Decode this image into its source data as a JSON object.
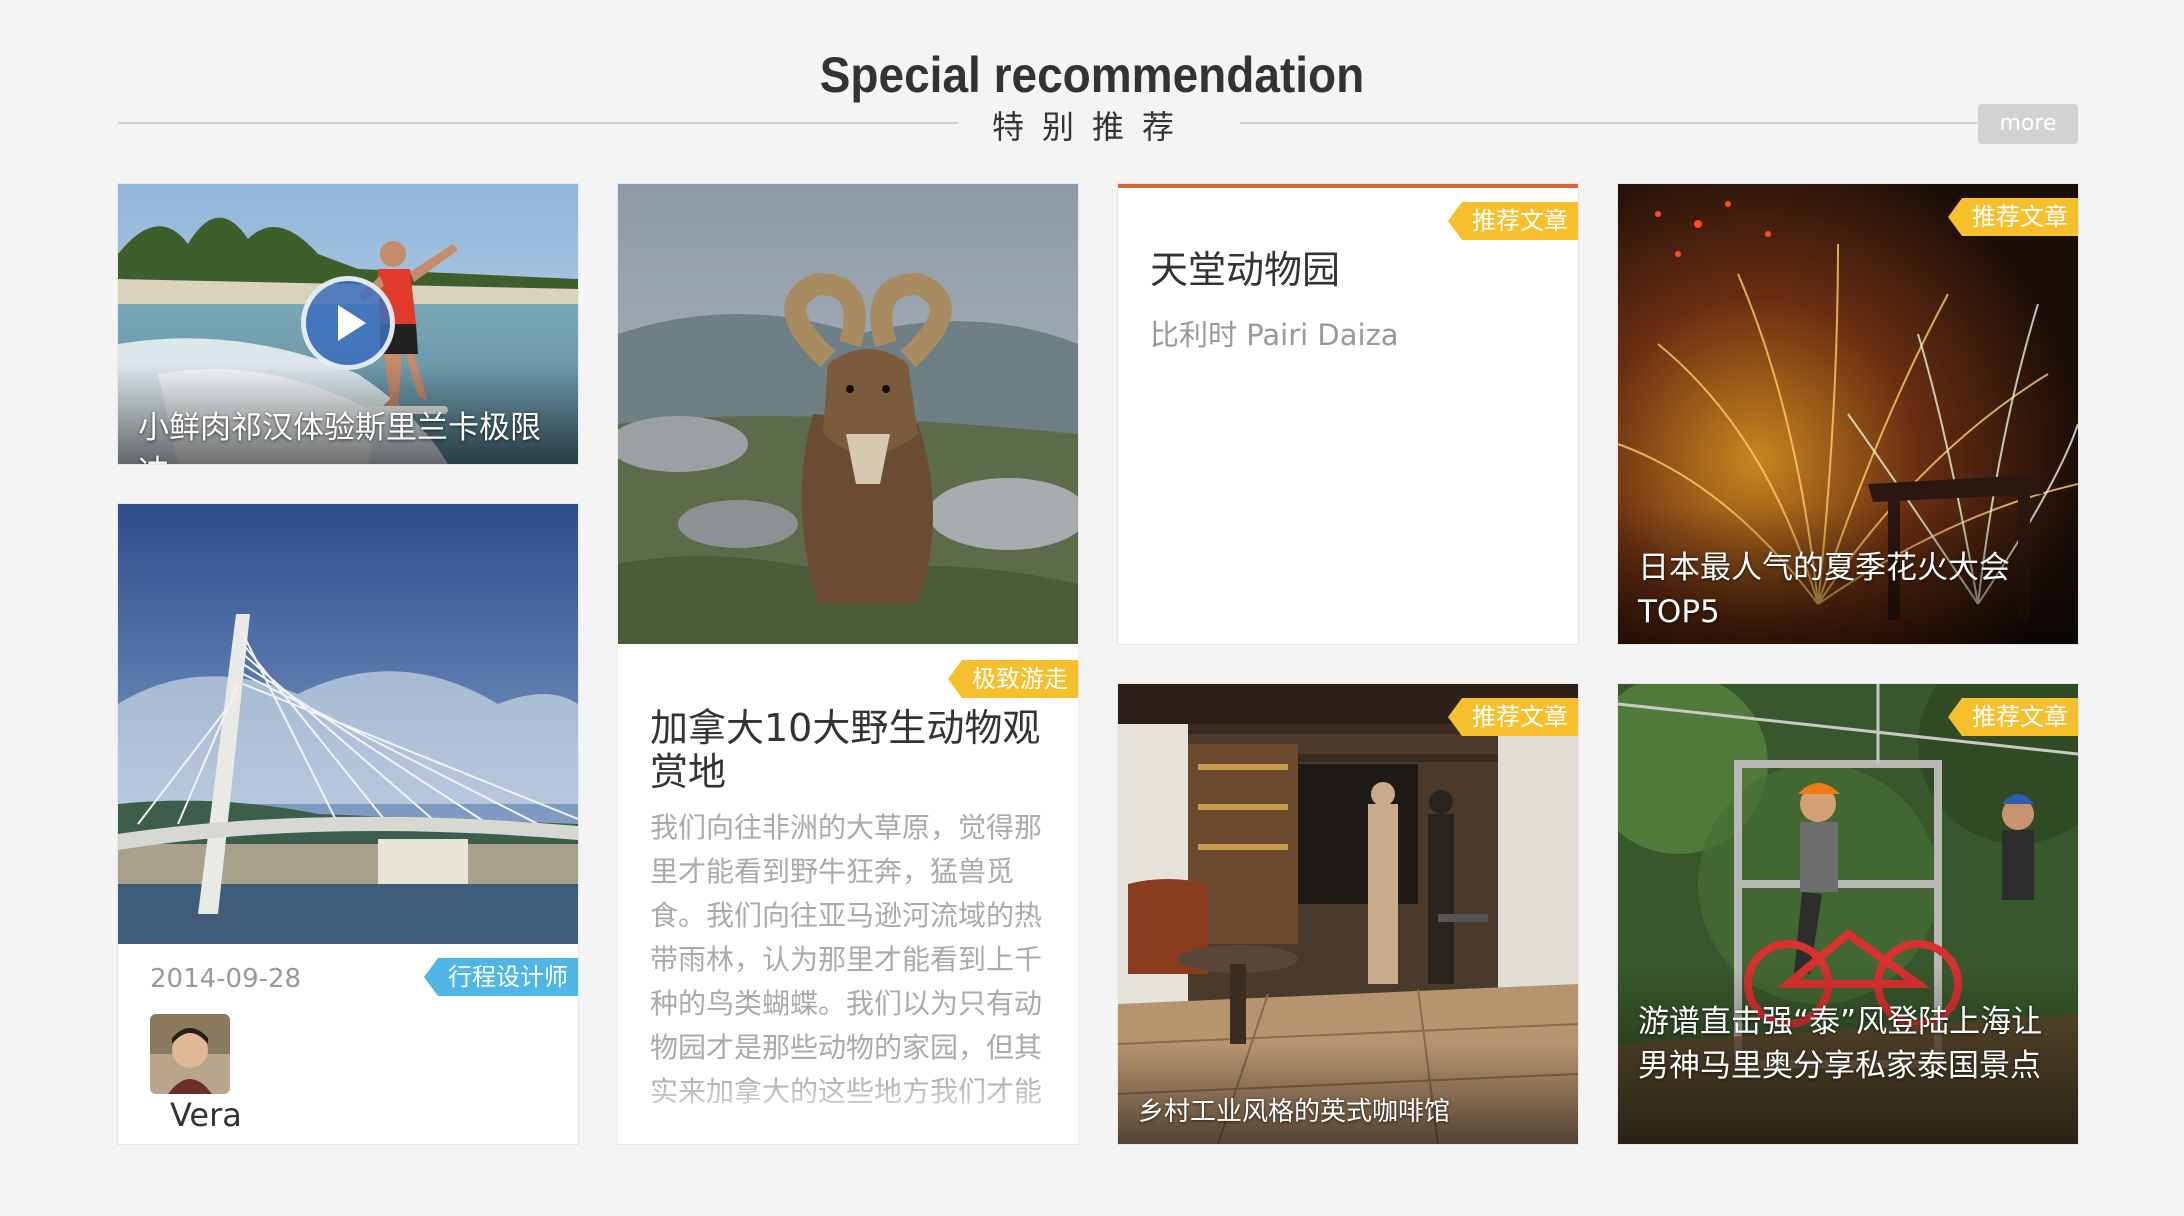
{
  "header": {
    "title": "Special recommendation",
    "subtitle": "特别推荐",
    "more_label": "more"
  },
  "cards": {
    "surf": {
      "caption": "小鲜肉祁汉体验斯里兰卡极限冲",
      "icon": "play-icon"
    },
    "bridge": {
      "date": "2014-09-28",
      "tag": "行程设计师",
      "author": "Vera"
    },
    "ram": {
      "tag": "极致游走",
      "title": "加拿大10大野生动物观赏地",
      "body": "我们向往非洲的大草原，觉得那里才能看到野牛狂奔，猛兽觅食。我们向往亚马逊河流域的热带雨林，认为那里才能看到上千种的鸟类蝴蝶。我们以为只有动物园才是那些动物的家园，但其实来加拿大的这些地方我们才能"
    },
    "zoo": {
      "tag": "推荐文章",
      "title": "天堂动物园",
      "subtitle": "比利时 Pairi Daiza"
    },
    "fireworks": {
      "tag": "推荐文章",
      "caption": "日本最人气的夏季花火大会TOP5"
    },
    "cafe": {
      "tag": "推荐文章",
      "caption": "乡村工业风格的英式咖啡馆"
    },
    "zipline": {
      "tag": "推荐文章",
      "caption": "游谱直击强“泰”风登陆上海让男神马里奥分享私家泰国景点"
    }
  },
  "colors": {
    "tag_yellow": "#f6c02c",
    "tag_blue": "#4fb6e6",
    "zoo_top_border": "#d9623b"
  }
}
